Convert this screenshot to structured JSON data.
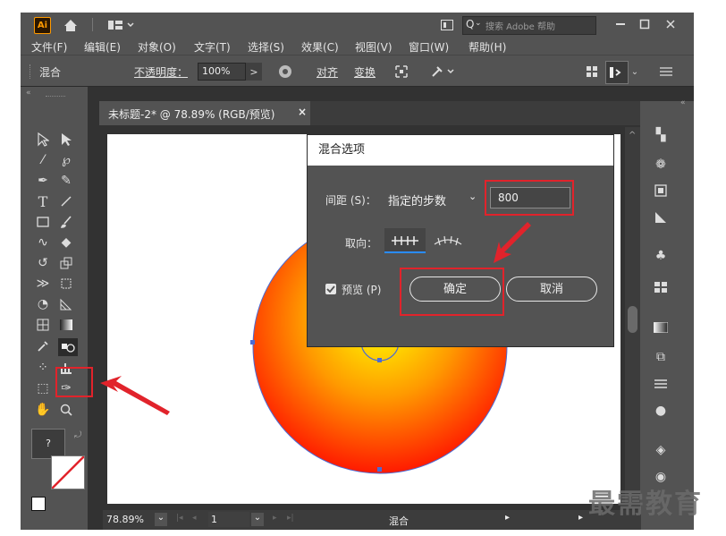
{
  "titlebar": {
    "app_badge": "Ai",
    "search_placeholder": "搜索 Adobe 帮助"
  },
  "menu": [
    "文件(F)",
    "编辑(E)",
    "对象(O)",
    "文字(T)",
    "选择(S)",
    "效果(C)",
    "视图(V)",
    "窗口(W)",
    "帮助(H)"
  ],
  "controlbar": {
    "object_label": "混合",
    "opacity_label": "不透明度：",
    "opacity_value": "100%",
    "align_label": "对齐",
    "transform_label": "变换"
  },
  "document_tab": {
    "title": "未标题-2* @ 78.89% (RGB/预览)",
    "close": "×"
  },
  "dialog": {
    "title": "混合选项",
    "spacing_label": "间距 (S)：",
    "spacing_mode": "指定的步数",
    "spacing_value": "800",
    "orientation_label": "取向：",
    "preview_label": "预览 (P)",
    "ok_label": "确定",
    "cancel_label": "取消"
  },
  "statusbar": {
    "zoom": "78.89%",
    "page": "1",
    "status_text": "混合"
  },
  "watermark": "最需教育",
  "colors": {
    "ui_bg": "#535353",
    "workspace": "#323232",
    "annotation_red": "#e1232b",
    "gradient_center": "#ffff00",
    "gradient_edge": "#ff1a00"
  }
}
